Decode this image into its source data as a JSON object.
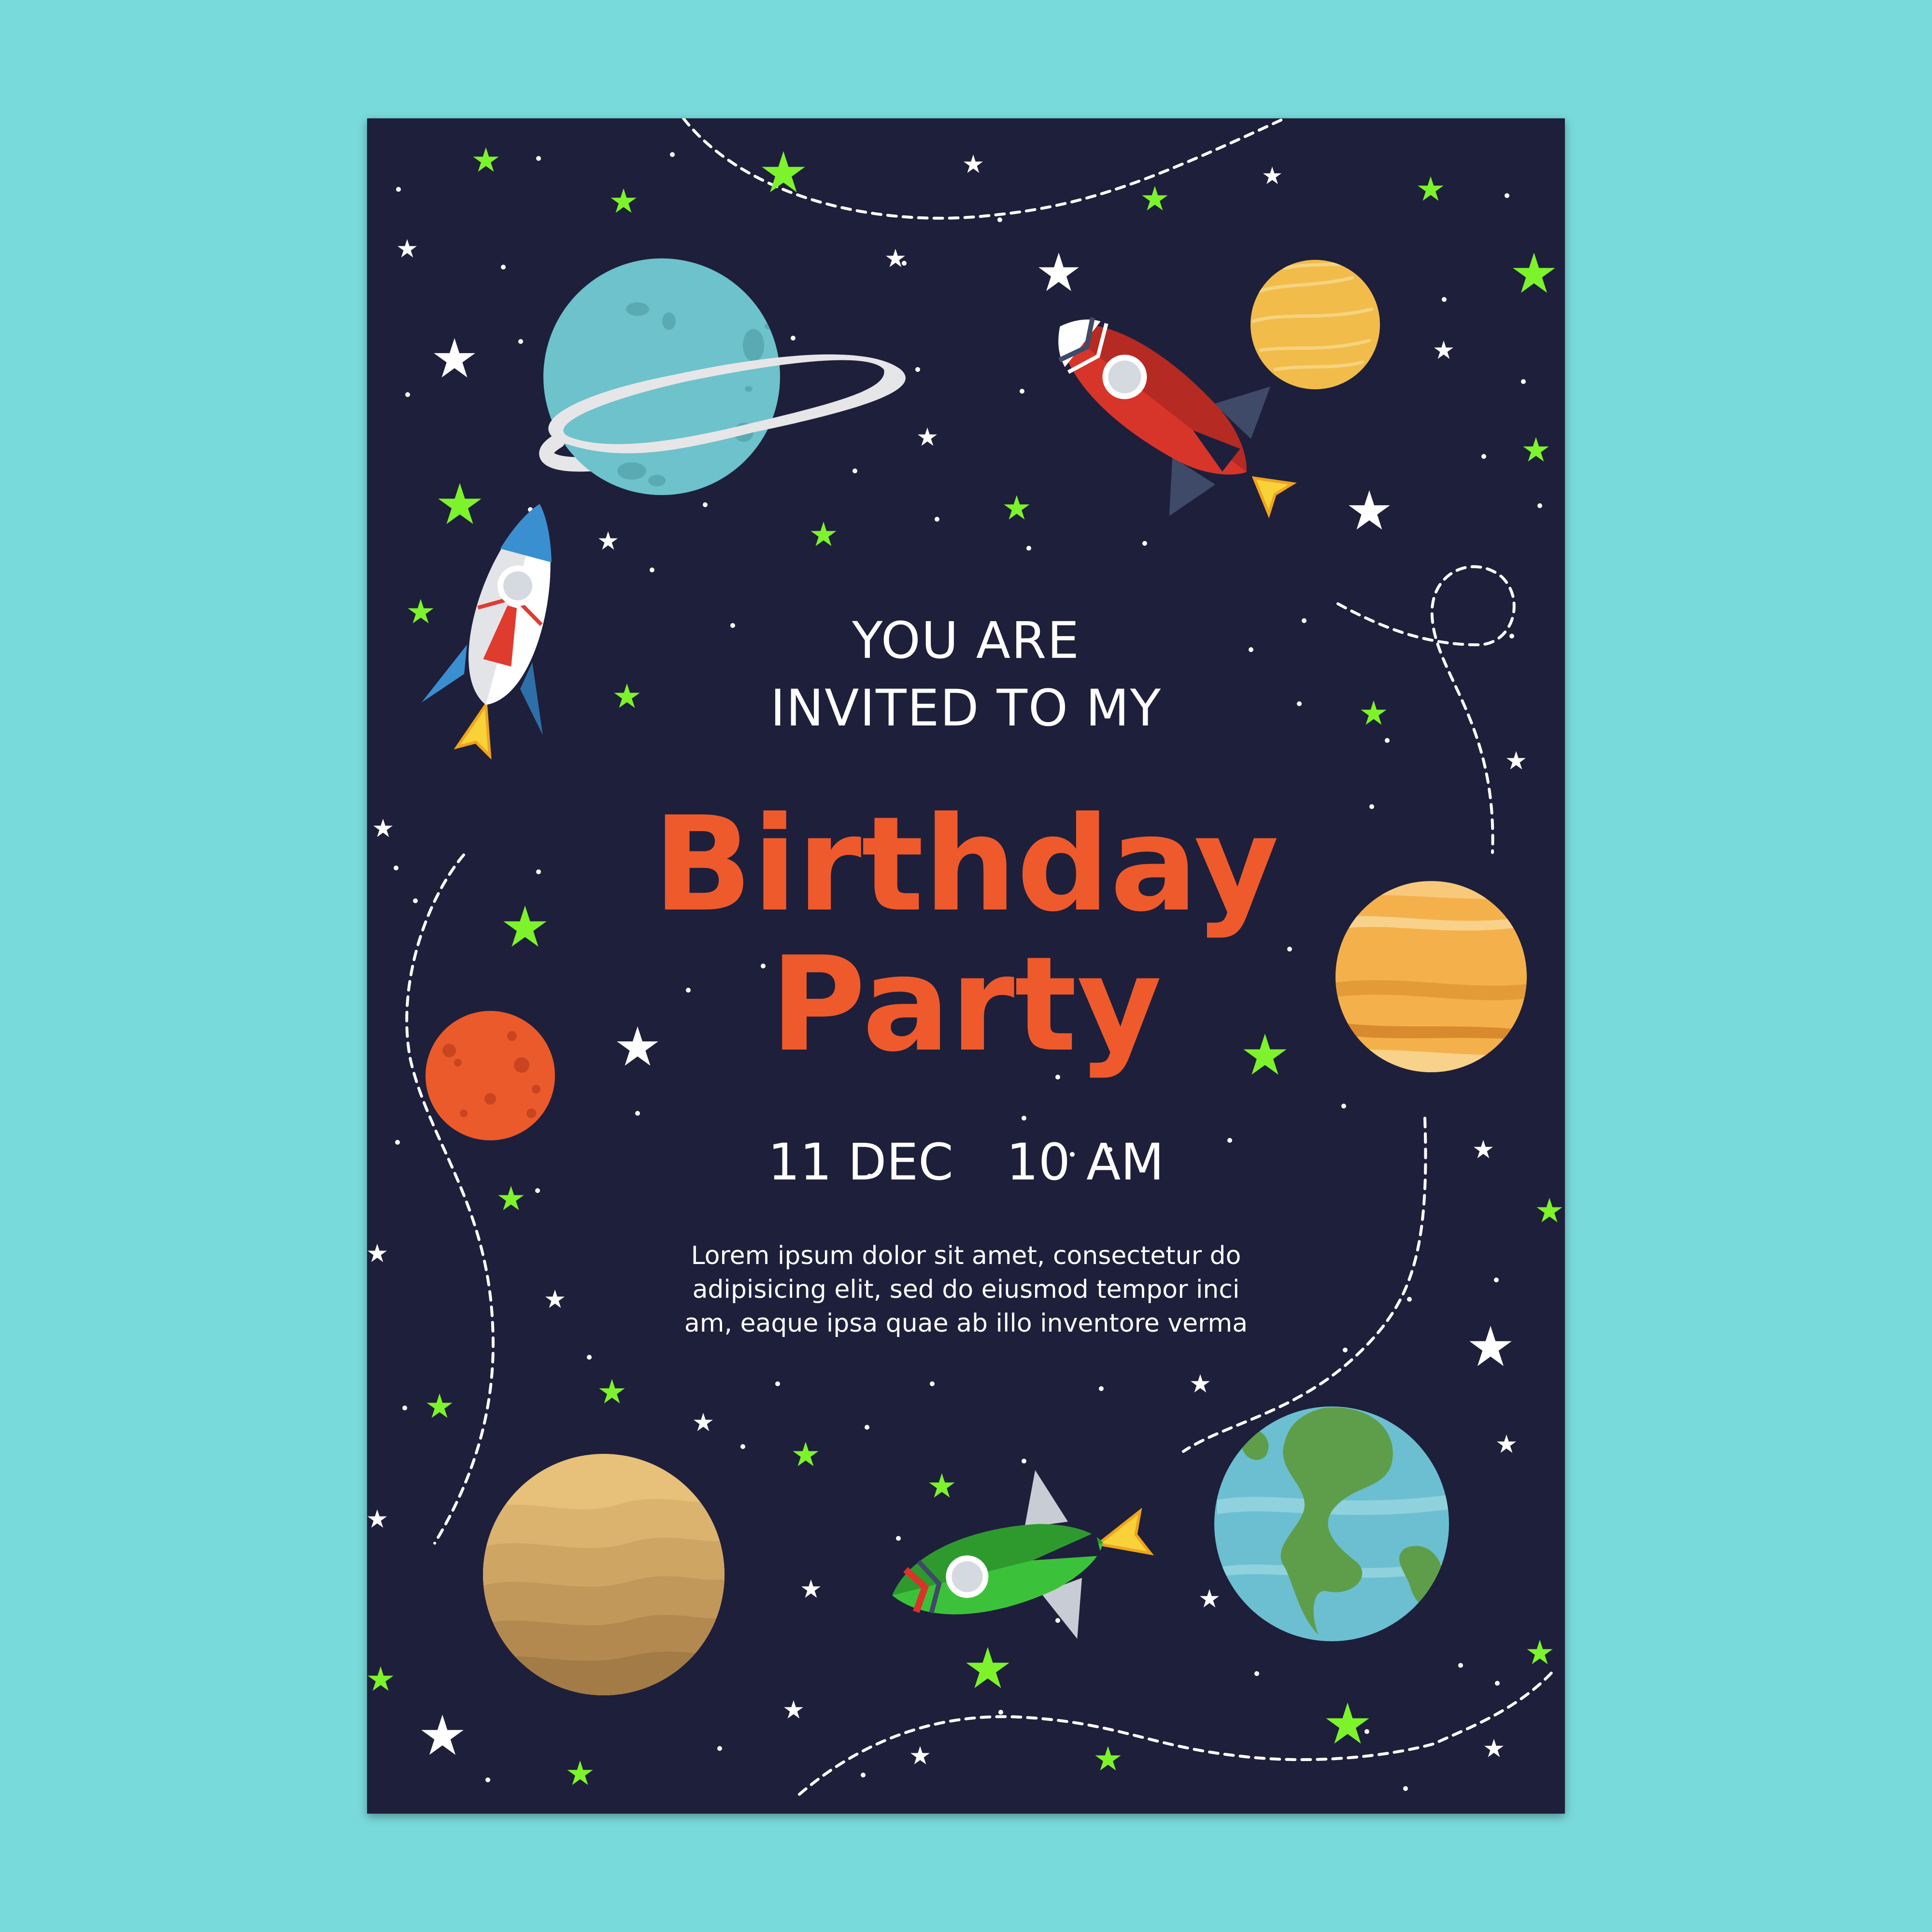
{
  "invitation": {
    "line_1": "YOU ARE",
    "line_2": "INVITED TO MY",
    "title_line_1": "Birthday",
    "title_line_2": "Party",
    "date": "11 DEC",
    "time": "10 AM",
    "body_lines": [
      "Lorem ipsum dolor sit amet, consectetur do",
      "adipisicing elit, sed do eiusmod tempor inci",
      "am, eaque ipsa quae ab illo inventore verma"
    ]
  },
  "colors": {
    "page_background": "#79dadb",
    "card_background": "#1e1f3b",
    "title": "#ee5a2c",
    "text": "#ffffff",
    "green_star": "#7df32b",
    "white_star": "#ffffff"
  },
  "illustrations": [
    "ringed-blue-planet",
    "yellow-planet",
    "red-rocket",
    "blue-rocket",
    "red-planet",
    "orange-striped-planet",
    "sand-planet",
    "green-rocket",
    "earth-like-planet"
  ]
}
